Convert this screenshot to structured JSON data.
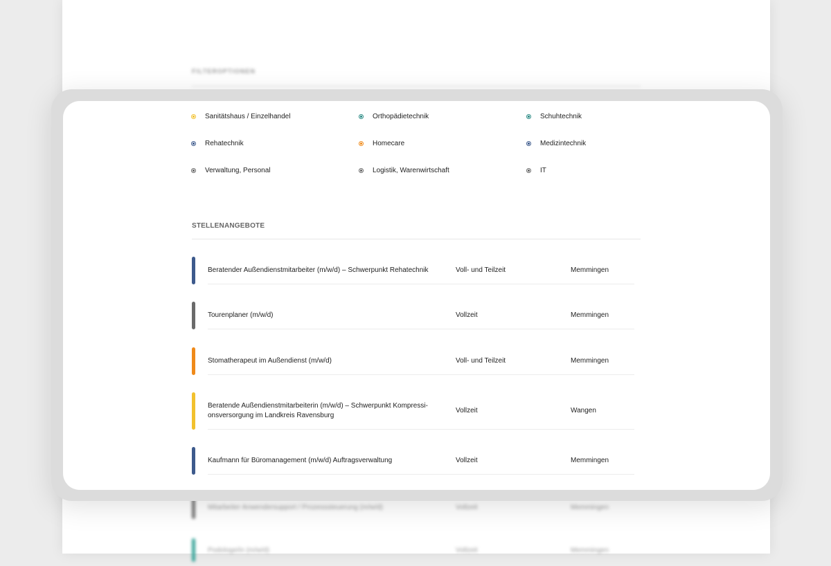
{
  "background": {
    "filter_title": "FILTEROPTIONEN",
    "jobs": [
      {
        "title": "Mitarbeiter Anwendersupport / Prozesssteuerung (m/w/d)",
        "employment": "Vollzeit",
        "location": "Memmingen",
        "color": "#777777"
      },
      {
        "title": "Podologe/in (m/w/d)",
        "employment": "Vollzeit",
        "location": "Memmingen",
        "color": "#3aa59a"
      }
    ]
  },
  "filters": [
    {
      "label": "Sanitätshaus / Einzelhandel",
      "color": "#f2c12e"
    },
    {
      "label": "Orthopädietechnik",
      "color": "#2a8a84"
    },
    {
      "label": "Schuhtechnik",
      "color": "#2a8a84"
    },
    {
      "label": "Rehatechnik",
      "color": "#3d5a8c"
    },
    {
      "label": "Homecare",
      "color": "#ef8a1a"
    },
    {
      "label": "Medizintechnik",
      "color": "#3d5a8c"
    },
    {
      "label": "Verwaltung, Personal",
      "color": "#666666"
    },
    {
      "label": "Logistik, Warenwirtschaft",
      "color": "#666666"
    },
    {
      "label": "IT",
      "color": "#666666"
    }
  ],
  "jobs_section": {
    "title": "STELLENANGEBOTE",
    "jobs": [
      {
        "title": "Beratender Außendienstmitarbeiter (m/w/d) – Schwerpunkt Rehatechnik",
        "employment": "Voll- und Teilzeit",
        "location": "Memmingen",
        "color": "#3d5a8c"
      },
      {
        "title": "Tourenplaner (m/w/d)",
        "employment": "Vollzeit",
        "location": "Memmingen",
        "color": "#6a6a6a"
      },
      {
        "title": "Stomatherapeut im Außendienst (m/w/d)",
        "employment": "Voll- und Teilzeit",
        "location": "Memmingen",
        "color": "#ef8a1a"
      },
      {
        "title": "Beratende Außendienstmitarbeiterin (m/w/d) – Schwerpunkt Kompressi­onsversorgung im Landkreis Ravensburg",
        "employment": "Vollzeit",
        "location": "Wangen",
        "color": "#f2c12e"
      },
      {
        "title": "Kaufmann für Büromanagement (m/w/d) Auftragsverwaltung",
        "employment": "Vollzeit",
        "location": "Memmingen",
        "color": "#3d5a8c"
      }
    ]
  }
}
